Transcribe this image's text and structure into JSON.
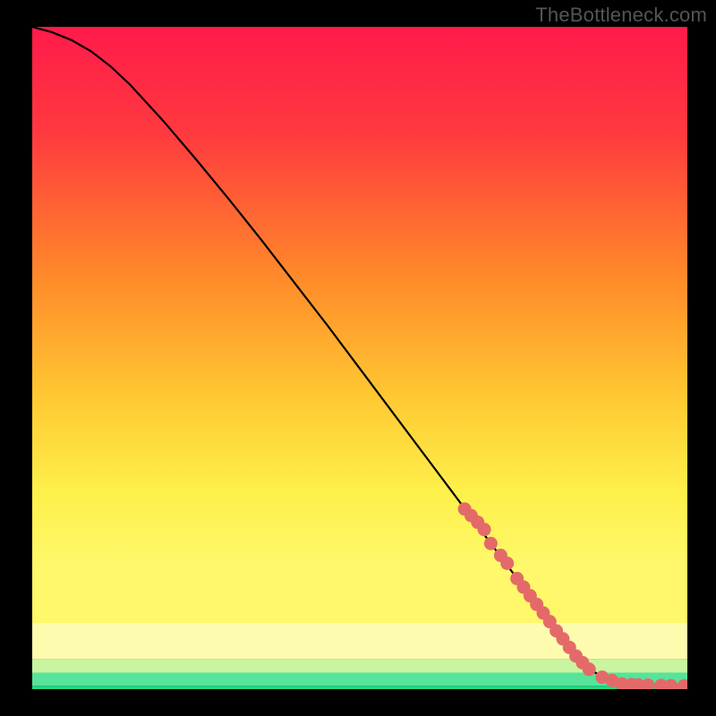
{
  "watermark": "TheBottleneck.com",
  "colors": {
    "curve": "#000000",
    "marker_fill": "#e46a6a",
    "marker_stroke": "#d85656",
    "band_green": "#2fe38a",
    "band_pale": "#d6f8b8",
    "band_yellow": "#fef65a",
    "grad_top": "#ff1a4a",
    "grad_mid": "#ffd23a",
    "grad_bot": "#fef65a"
  },
  "chart_data": {
    "type": "line",
    "title": "",
    "xlabel": "",
    "ylabel": "",
    "xlim": [
      0,
      100
    ],
    "ylim": [
      0,
      100
    ],
    "grid": false,
    "legend": false,
    "series": [
      {
        "name": "curve",
        "x": [
          0,
          3,
          6,
          9,
          12,
          15,
          20,
          25,
          30,
          35,
          40,
          45,
          50,
          55,
          60,
          65,
          70,
          75,
          80,
          83,
          85,
          88,
          90,
          92,
          94,
          96,
          98,
          100
        ],
        "y": [
          100,
          99.2,
          98.0,
          96.3,
          94.0,
          91.2,
          85.8,
          80.0,
          74.0,
          67.8,
          61.4,
          55.0,
          48.4,
          41.8,
          35.2,
          28.6,
          22.0,
          15.4,
          8.8,
          5.0,
          3.0,
          1.4,
          0.8,
          0.6,
          0.55,
          0.52,
          0.51,
          0.5
        ]
      }
    ],
    "markers": {
      "name": "highlighted-range",
      "x": [
        66,
        67,
        68,
        69,
        70,
        71.5,
        72.5,
        74,
        75,
        76,
        77,
        78,
        79,
        80,
        81,
        82,
        83,
        84,
        85,
        87,
        88.5,
        90,
        91.5,
        92.5,
        94,
        96,
        97.5,
        99.5
      ],
      "y": [
        27.2,
        26.2,
        25.2,
        24.1,
        22.0,
        20.2,
        19.0,
        16.7,
        15.4,
        14.1,
        12.8,
        11.5,
        10.2,
        8.8,
        7.6,
        6.3,
        5.0,
        4.0,
        3.0,
        1.8,
        1.3,
        0.8,
        0.7,
        0.65,
        0.6,
        0.55,
        0.53,
        0.5
      ]
    },
    "gradient_stops": [
      {
        "offset": 0.0,
        "color": "#ff1a4a"
      },
      {
        "offset": 0.18,
        "color": "#ff3a3f"
      },
      {
        "offset": 0.42,
        "color": "#ff8a2a"
      },
      {
        "offset": 0.62,
        "color": "#ffc832"
      },
      {
        "offset": 0.78,
        "color": "#fef04a"
      },
      {
        "offset": 0.9,
        "color": "#fef86a"
      }
    ],
    "bottom_bands": [
      {
        "from_y": 0.9,
        "to_y": 0.955,
        "color": "#fdfcae"
      },
      {
        "from_y": 0.955,
        "to_y": 0.975,
        "color": "#c9f4a0"
      },
      {
        "from_y": 0.975,
        "to_y": 0.995,
        "color": "#57e39a"
      },
      {
        "from_y": 0.995,
        "to_y": 1.0,
        "color": "#1fd982"
      }
    ]
  }
}
